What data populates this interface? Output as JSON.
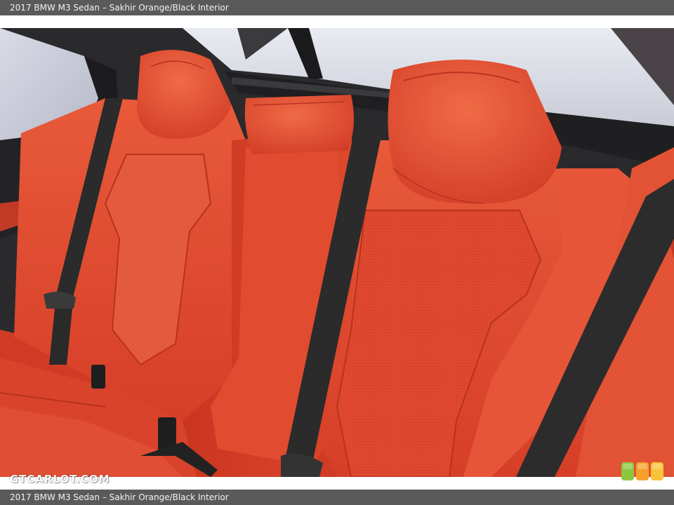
{
  "caption": {
    "title": "2017 BMW M3 Sedan – Sakhir Orange/Black Interior"
  },
  "watermark": {
    "text": "GTCARLOT.COM"
  },
  "colors": {
    "caption_bg": "#5a5a5a",
    "leather_orange": "#e0492f",
    "belt_black": "#2b2b2b",
    "badge_green": "#8cc63f",
    "badge_orange": "#f6a02b",
    "badge_yellow": "#f9c23c"
  },
  "photo": {
    "subject": "rear bench seat"
  }
}
